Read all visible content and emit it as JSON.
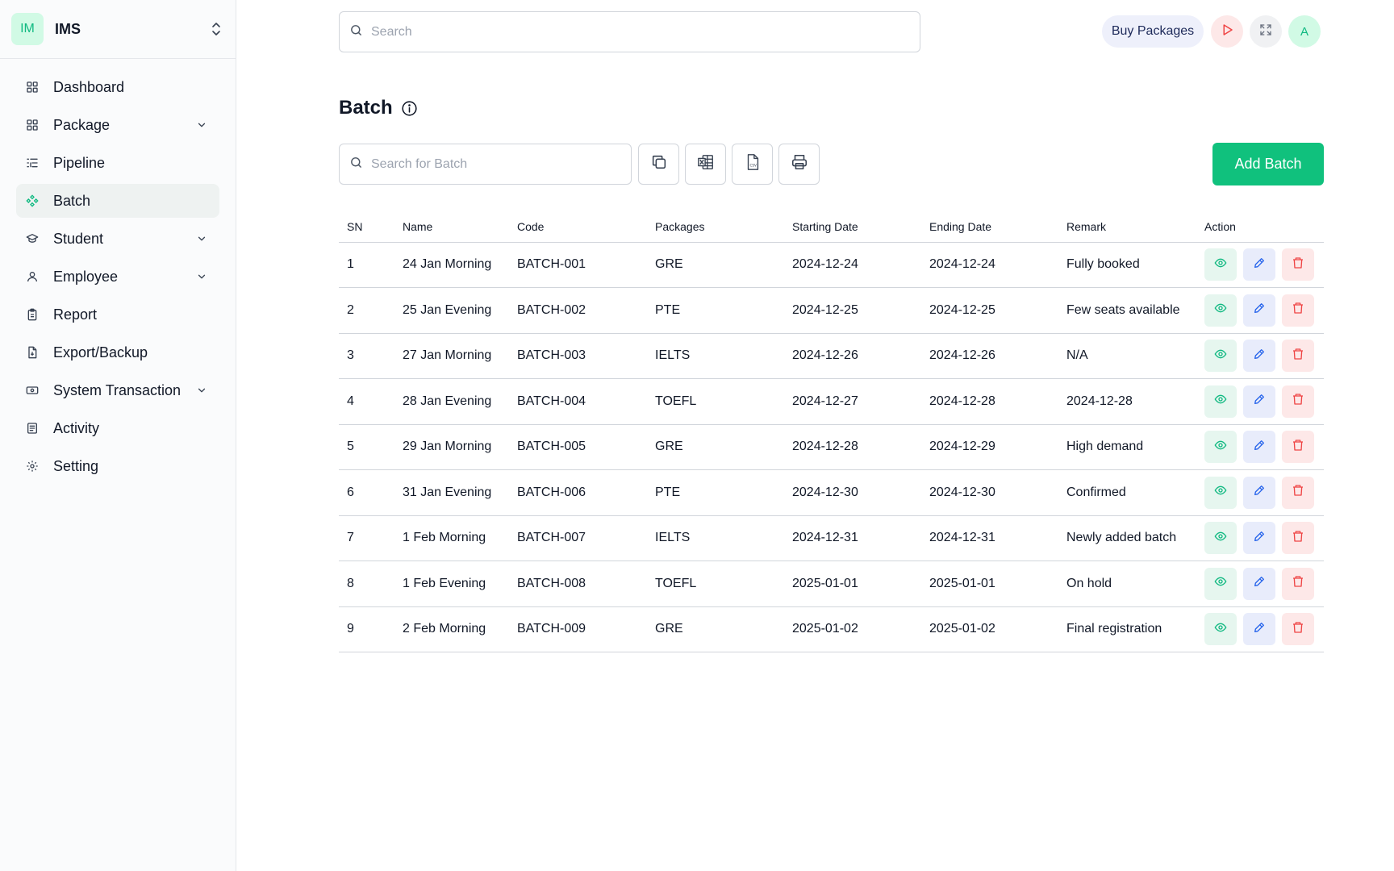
{
  "brand": {
    "initials": "IM",
    "name": "IMS"
  },
  "sidebar": {
    "items": [
      {
        "label": "Dashboard",
        "icon": "grid-icon",
        "expandable": false,
        "active": false
      },
      {
        "label": "Package",
        "icon": "grid-icon",
        "expandable": true,
        "active": false
      },
      {
        "label": "Pipeline",
        "icon": "list-icon",
        "expandable": false,
        "active": false
      },
      {
        "label": "Batch",
        "icon": "batch-icon",
        "expandable": false,
        "active": true
      },
      {
        "label": "Student",
        "icon": "graduation-cap-icon",
        "expandable": true,
        "active": false
      },
      {
        "label": "Employee",
        "icon": "user-icon",
        "expandable": true,
        "active": false
      },
      {
        "label": "Report",
        "icon": "clipboard-icon",
        "expandable": false,
        "active": false
      },
      {
        "label": "Export/Backup",
        "icon": "file-export-icon",
        "expandable": false,
        "active": false
      },
      {
        "label": "System Transaction",
        "icon": "banknote-icon",
        "expandable": true,
        "active": false
      },
      {
        "label": "Activity",
        "icon": "activity-log-icon",
        "expandable": false,
        "active": false
      },
      {
        "label": "Setting",
        "icon": "gear-icon",
        "expandable": false,
        "active": false
      }
    ]
  },
  "topbar": {
    "search_placeholder": "Search",
    "buy_label": "Buy Packages",
    "avatar_initial": "A"
  },
  "page": {
    "title": "Batch",
    "search_placeholder": "Search for Batch",
    "add_label": "Add Batch"
  },
  "colors": {
    "accent": "#10c17d",
    "view": "#10b981",
    "edit": "#2563eb",
    "delete": "#ef4444"
  },
  "table": {
    "headers": [
      "SN",
      "Name",
      "Code",
      "Packages",
      "Starting Date",
      "Ending Date",
      "Remark",
      "Action"
    ],
    "rows": [
      [
        "1",
        "24 Jan Morning",
        "BATCH-001",
        "GRE",
        "2024-12-24",
        "2024-12-24",
        "Fully booked"
      ],
      [
        "2",
        "25 Jan Evening",
        "BATCH-002",
        "PTE",
        "2024-12-25",
        "2024-12-25",
        "Few seats available"
      ],
      [
        "3",
        "27 Jan Morning",
        "BATCH-003",
        "IELTS",
        "2024-12-26",
        "2024-12-26",
        "N/A"
      ],
      [
        "4",
        "28 Jan Evening",
        "BATCH-004",
        "TOEFL",
        "2024-12-27",
        "2024-12-28",
        "2024-12-28"
      ],
      [
        "5",
        "29 Jan Morning",
        "BATCH-005",
        "GRE",
        "2024-12-28",
        "2024-12-29",
        "High demand"
      ],
      [
        "6",
        "31 Jan Evening",
        "BATCH-006",
        "PTE",
        "2024-12-30",
        "2024-12-30",
        "Confirmed"
      ],
      [
        "7",
        "1 Feb Morning",
        "BATCH-007",
        "IELTS",
        "2024-12-31",
        "2024-12-31",
        "Newly added batch"
      ],
      [
        "8",
        "1 Feb Evening",
        "BATCH-008",
        "TOEFL",
        "2025-01-01",
        "2025-01-01",
        "On hold"
      ],
      [
        "9",
        "2 Feb Morning",
        "BATCH-009",
        "GRE",
        "2025-01-02",
        "2025-01-02",
        "Final registration"
      ]
    ]
  }
}
